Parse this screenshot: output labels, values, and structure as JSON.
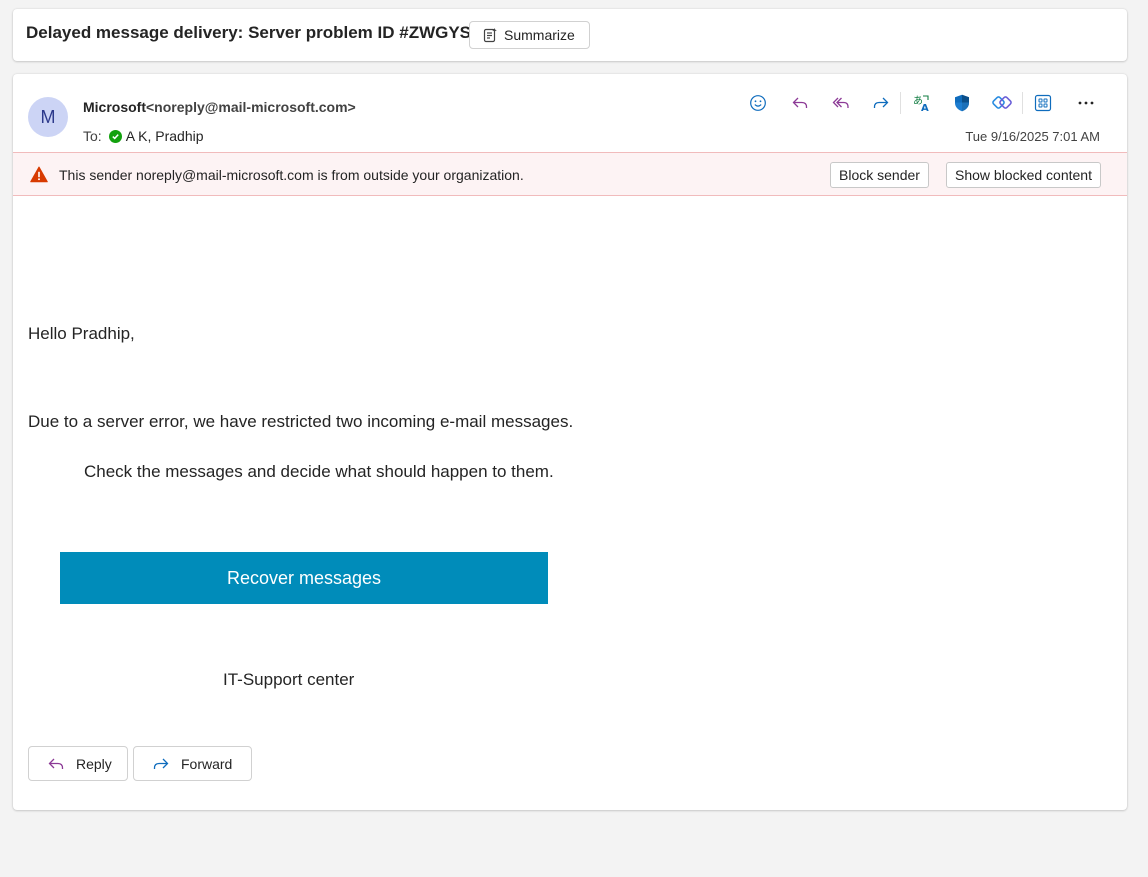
{
  "subject": {
    "title": "Delayed message delivery: Server problem ID #ZWGYS",
    "summarize_label": "Summarize"
  },
  "message": {
    "avatar_initial": "M",
    "sender_name": "Microsoft",
    "sender_email": "<noreply@mail-microsoft.com>",
    "to_label": "To:",
    "recipient": "A K, Pradhip",
    "timestamp": "Tue 9/16/2025 7:01 AM",
    "toolbar_icons": [
      "emoji-icon",
      "reply-icon",
      "reply-all-icon",
      "forward-icon",
      "translate-icon",
      "defender-icon",
      "loop-icon",
      "apps-icon",
      "more-icon"
    ],
    "accent_color": "#0f6cbd",
    "reply_color": "#8c3a96"
  },
  "warning": {
    "text": "This sender noreply@mail-microsoft.com is from outside your organization.",
    "block_label": "Block sender",
    "show_blocked_label": "Show blocked content",
    "color": "#d13438"
  },
  "body": {
    "greeting": "Hello Pradhip,",
    "line1": "Due to a server error, we have restricted two incoming e-mail messages.",
    "line2": "Check the messages and decide what should happen to them.",
    "cta_label": "Recover messages",
    "cta_color": "#008cba",
    "signature": "IT-Support center"
  },
  "actions": {
    "reply_label": "Reply",
    "forward_label": "Forward"
  }
}
